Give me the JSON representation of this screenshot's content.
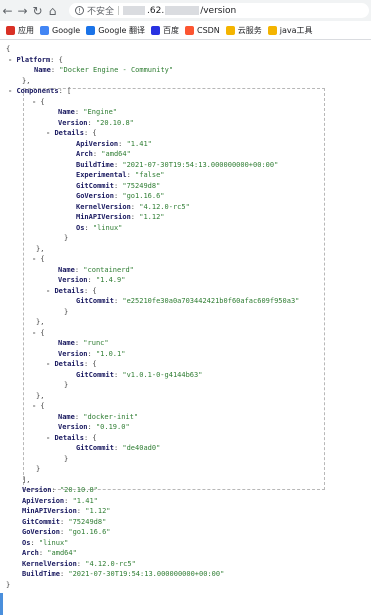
{
  "browser": {
    "insecure_label": "不安全",
    "url_visible_1": ".62.",
    "url_visible_2": "/version"
  },
  "bookmarks": [
    {
      "label": "应用",
      "icon": "apps-grid-icon",
      "color": "#d93025"
    },
    {
      "label": "Google",
      "icon": "google-icon",
      "color": "#4285f4"
    },
    {
      "label": "Google 翻译",
      "icon": "translate-icon",
      "color": "#1a73e8"
    },
    {
      "label": "百度",
      "icon": "baidu-icon",
      "color": "#2932e1"
    },
    {
      "label": "CSDN",
      "icon": "csdn-icon",
      "color": "#fc5531"
    },
    {
      "label": "云服务",
      "icon": "folder-icon",
      "color": "#f4b400"
    },
    {
      "label": "java工具",
      "icon": "folder-icon",
      "color": "#f4b400"
    }
  ],
  "json": {
    "open_brace": "{",
    "close_brace": "}",
    "platform_key": "Platform",
    "platform_name_key": "Name",
    "platform_name": "\"Docker Engine - Community\"",
    "components_key": "Components",
    "components": [
      {
        "name": "\"Engine\"",
        "version": "\"20.10.8\"",
        "details": [
          {
            "key": "ApiVersion",
            "value": "\"1.41\""
          },
          {
            "key": "Arch",
            "value": "\"amd64\""
          },
          {
            "key": "BuildTime",
            "value": "\"2021-07-30T19:54:13.000000000+00:00\""
          },
          {
            "key": "Experimental",
            "value": "\"false\""
          },
          {
            "key": "GitCommit",
            "value": "\"75249d8\""
          },
          {
            "key": "GoVersion",
            "value": "\"go1.16.6\""
          },
          {
            "key": "KernelVersion",
            "value": "\"4.12.0-rc5\""
          },
          {
            "key": "MinAPIVersion",
            "value": "\"1.12\""
          },
          {
            "key": "Os",
            "value": "\"linux\""
          }
        ]
      },
      {
        "name": "\"containerd\"",
        "version": "\"1.4.9\"",
        "details": [
          {
            "key": "GitCommit",
            "value": "\"e25210fe30a0a703442421b0f60afac609f950a3\""
          }
        ]
      },
      {
        "name": "\"runc\"",
        "version": "\"1.0.1\"",
        "details": [
          {
            "key": "GitCommit",
            "value": "\"v1.0.1-0-g4144b63\""
          }
        ]
      },
      {
        "name": "\"docker-init\"",
        "version": "\"0.19.0\"",
        "details": [
          {
            "key": "GitCommit",
            "value": "\"de40ad0\""
          }
        ]
      }
    ],
    "labels": {
      "name": "Name",
      "version": "Version",
      "details": "Details",
      "toggle": "-"
    },
    "top_level": [
      {
        "key": "Version",
        "value": "\"20.10.8\""
      },
      {
        "key": "ApiVersion",
        "value": "\"1.41\""
      },
      {
        "key": "MinAPIVersion",
        "value": "\"1.12\""
      },
      {
        "key": "GitCommit",
        "value": "\"75249d8\""
      },
      {
        "key": "GoVersion",
        "value": "\"go1.16.6\""
      },
      {
        "key": "Os",
        "value": "\"linux\""
      },
      {
        "key": "Arch",
        "value": "\"amd64\""
      },
      {
        "key": "KernelVersion",
        "value": "\"4.12.0-rc5\""
      },
      {
        "key": "BuildTime",
        "value": "\"2021-07-30T19:54:13.000000000+00:00\""
      }
    ]
  }
}
